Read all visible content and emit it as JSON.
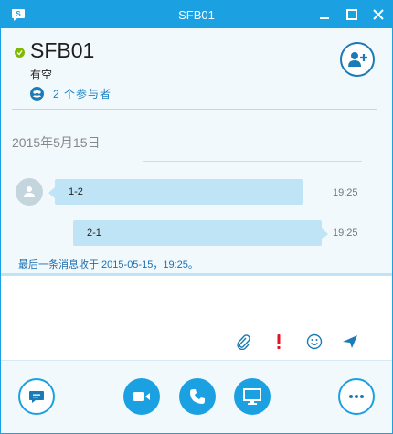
{
  "window": {
    "title": "SFB01",
    "accent_color": "#1ba1e2",
    "controls": [
      "minimize-icon",
      "maximize-icon",
      "close-icon"
    ]
  },
  "header": {
    "contact_name": "SFB01",
    "presence_status": "有空",
    "presence_color": "#7fba00",
    "participants_label": "2 个参与者"
  },
  "conversation": {
    "date": "2015年5月15日",
    "messages": [
      {
        "text": "1-2",
        "time": "19:25",
        "direction": "incoming"
      },
      {
        "text": "2-1",
        "time": "19:25",
        "direction": "outgoing"
      }
    ],
    "last_message_note": "最后一条消息收于 2015-05-15，19:25。"
  },
  "compose": {
    "placeholder": "",
    "tools": [
      "paperclip-icon",
      "importance-icon",
      "emoticon-icon",
      "send-icon"
    ]
  },
  "bottom_bar": {
    "buttons": [
      "im-icon",
      "video-icon",
      "phone-icon",
      "present-screen-icon",
      "more-options-icon"
    ]
  }
}
